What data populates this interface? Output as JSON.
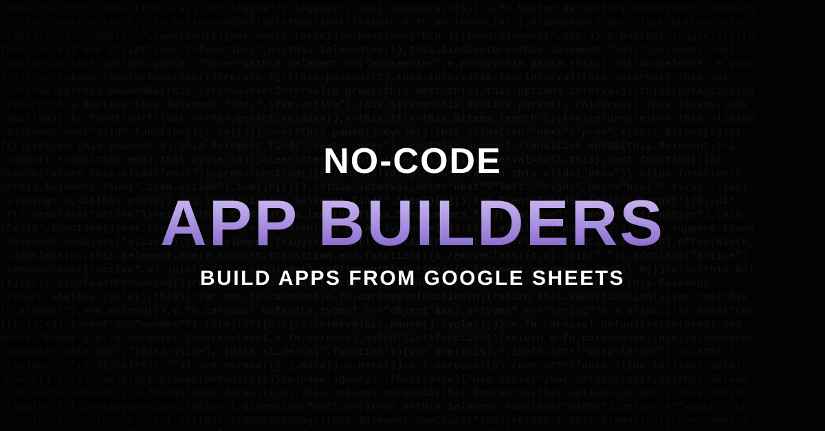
{
  "hero": {
    "line1": "NO-CODE",
    "line2": "APP BUILDERS",
    "line3": "BUILD APPS FROM GOOGLE SHEETS"
  },
  "background_code": ".data(\"button\",i=new t(this,s)),n==\"toggle\"?i.toggle(n):n&&i.setState(n)})},e.fn.button.defaults={loadingText:\"loading\n.button.Constructor=t,e.fn.button.noConflict=function(){return e.fn.button=n,this},e(document).on(\"click.button.data-\n\"[data-toggle^=button]\",function(t){var n=e(t.target);n.hasClass(\"btn\")||(n=n.closest(\".btn\")),n.button(\"toggle\")})}(w\nfunction(e){\"use strict\";var t=function(t,n){this.$element=e(t),this.$indicators=this.$element.find(\".carousel-indi\n.options=n,this.options.pause==\"hover\"&&this.$element.on(\"mouseenter\",e.proxy(this.pause,this)).on(\"mouseleave\",e.prox\n))};t.prototype={cycle:function(t){return t||(this.paused=!1),this.interval&&clearInterval(this.interval),this.opt\n.interval&&!this.paused&&(this.interval=setInterval(e.proxy(this.next,this),this.options.interval)),this},getActiveInd\n{return this.$active=this.$element.find(\".item.active\"),this.$items=this.$active.parent().children(),this.$items.inde\n.$active)},to:function(t){var n=this.getActiveIndex(),r=this;if(t>this.$items.length-1||t<0)return;return this.sliding\n.$element.one(\"slid\",function(){r.to(t)}):n==t?this.pause().cycle():this.slide(t>n?\"next\":\"prev\",e(this.$items[t]))},\nf(t){return this.paused=!0),this.$element.find(\".next, .prev\").length&&e.support.transition.end&&(this.$element.tri\n.support.transition.end),this.cycle(!0)),clearInterval(this.interval),this.interval=null,this},next:function(){if\nreturn;return this.slide(\"next\")},prev:function(){if(this.sliding)return;return this.slide(\"prev\")},slide:function(t,\nr=this.$element.find(\".item.active\"),i=n||r[t](),s=this.interval,o=t==\"next\"?\"left\":\"right\",u=t==\"next\"?\"first\":\"last\"\n.sliding=!0,s&&this.pause(),i=i.length?i:this.$element.find(\".item\")[u](),l=e.Event(\"slide\",{relatedTarget:i[0],dir\nif(i.hasClass(\"active\"))return;this.$indicators.length&&(this.$indicators.find(\".active\").removeClass(\"active\"),this\n(\"slid\",function(){var t=e(a.$indicators.children()[a.getActiveIndex()]);t&&t.addClass(\"active\")}));if(e.support.trans\n.$element.hasClass(\"slide\")){this.$element.trigger(l);if(l.isDefaultPrevented())return;i.addClass(t),i[0].offsetWidth,\ni.addClass(o),this.$element.one(e.support.transition.end,function(){i.removeClass([t,o].join(\" \")).addClass(\"active\")\n.removeClass([\"active\",o].join(\" \")),a.sliding=!1,setTimeout(function(){a.$element.trigger(\"slid\")},0)})}else{this.$el\n(f);if(f.isDefaultPrevented())return;r.removeClass(\"active\"),i.addClass(\"active\"),this.sliding=!1,this.$element\n{return s&&this.cycle(),this}};var n=e.fn.carousel;e.fn.carousel=function(n){return this.each(function(){var r=e(this\n(\"carousel\"),s=e.extend({},e.fn.carousel.defaults,typeof n==\"object\"&&n),o=typeof n==\"string\"?n:s.slide;i||r.data(\"car\nt(this,s)),typeof n==\"number\"?i.to(n):o?i[o]():s.interval&&i.pause().cycle()})},e.fn.carousel.defaults={interval:5e3,\npause:\"hover\"},e.fn.carousel.Constructor=t,e.fn.carousel.noConflict=function(){return e.fn.carousel=n,this},e(document\n.carousel.data-api\",\"[data-slide], [data-slide-to]\",function(t){var n=e(this),r,i=e(n.attr(\"data-target\")||n.attr(\"\n.replace(/.*(?=#[^\\s]+$)/,\"\")),s=e.extend({},i.data(),n.data()),o;i.carousel(s),(o=n.attr(\"data-slide-to\"))&&i.data(\"\n.pause().to(o).cycle(),t.preventDefault()})}(window.jQuery),!function(e){\"use strict\";var t=function(t,n){this.$eleme\n.options=e.extend({},e.fn.collapse.defaults,n),this.options.parent&&(this.$parent=e(this.options.parent)),this.option\n.toggle()};t.prototype={constructor:t,dimension:function(){var e=this.$element.hasClass(\"width\");return e?\"width\":\"he\nshow:function(){var t,n,r,i;if(this.transitioning||this.$element.hasClass(\"in\"))return;t=this.dimension(),n=e.camelCa\n].join(\"-\")),r=this.$parent&&this.$parent.find(\"> .accordion-group > .in\");if(r&&r.length){i=r.data(\"collapse\")"
}
